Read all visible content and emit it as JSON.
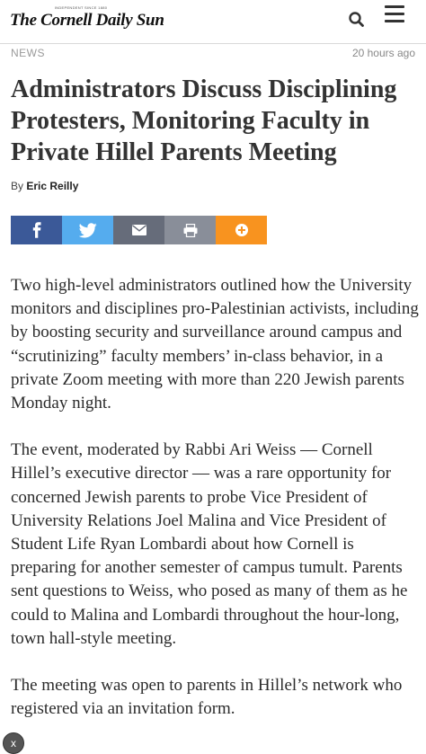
{
  "header": {
    "tagline": "INDEPENDENT SINCE 1880",
    "logo": "The Cornell Daily Sun",
    "search_icon": "search-icon",
    "menu_icon": "hamburger-menu-icon"
  },
  "article": {
    "section": "NEWS",
    "timestamp": "20 hours ago",
    "headline": "Administrators Discuss Disciplining Protesters, Monitoring Faculty in Private Hillel Parents Meeting",
    "byline_prefix": "By",
    "author": "Eric Reilly",
    "paragraphs": [
      "Two high-level administrators outlined how the University monitors and disciplines pro-Palestinian activists, including by boosting security and surveillance around campus and “scrutinizing” faculty members’ in-class behavior, in a private Zoom meeting with more than 220 Jewish parents Monday night.",
      "The event, moderated by Rabbi Ari Weiss — Cornell Hillel’s executive director — was a rare opportunity for concerned Jewish parents to probe Vice President of University Relations Joel Malina and Vice President of Student Life Ryan Lombardi about how Cornell is preparing for another semester of campus tumult. Parents sent questions to Weiss, who posed as many of them as he could to Malina and Lombardi throughout the hour-long, town hall-style meeting.",
      "The meeting was open to parents in Hillel’s network who registered via an invitation form."
    ]
  },
  "share": {
    "buttons": [
      {
        "icon": "facebook-icon",
        "color": "#3b5998"
      },
      {
        "icon": "twitter-icon",
        "color": "#55acee"
      },
      {
        "icon": "email-icon",
        "color": "#666c7a"
      },
      {
        "icon": "print-icon",
        "color": "#898e99"
      },
      {
        "icon": "plus-icon",
        "color": "#f8931f"
      }
    ]
  },
  "overlay": {
    "close_label": "x"
  }
}
